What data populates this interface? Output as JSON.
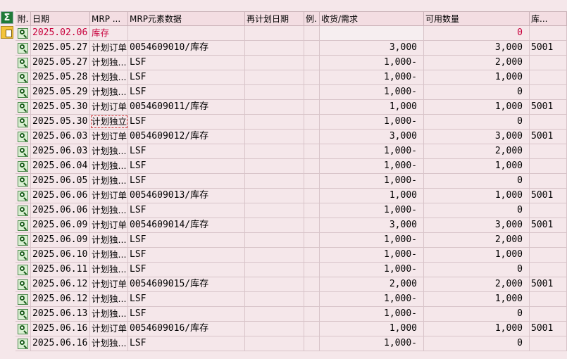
{
  "toolbar": {
    "sum_glyph": "Σ"
  },
  "columns": {
    "att": "附.",
    "date": "日期",
    "mrp": "MRP ...",
    "elem": "MRP元素数据",
    "resched": "再计划日期",
    "ex": "例.",
    "recv": "收货/需求",
    "avail": "可用数量",
    "stor": "库..."
  },
  "rows": [
    {
      "date": "2025.02.06",
      "mrp": "库存",
      "elem": "",
      "recv": "",
      "avail": "0",
      "stor": ""
    },
    {
      "date": "2025.05.27",
      "mrp": "计划订单",
      "elem": "0054609010/库存",
      "recv": "3,000",
      "avail": "3,000",
      "stor": "5001"
    },
    {
      "date": "2025.05.27",
      "mrp": "计划独...",
      "elem": "LSF",
      "recv": "1,000-",
      "avail": "2,000",
      "stor": ""
    },
    {
      "date": "2025.05.28",
      "mrp": "计划独...",
      "elem": "LSF",
      "recv": "1,000-",
      "avail": "1,000",
      "stor": ""
    },
    {
      "date": "2025.05.29",
      "mrp": "计划独...",
      "elem": "LSF",
      "recv": "1,000-",
      "avail": "0",
      "stor": ""
    },
    {
      "date": "2025.05.30",
      "mrp": "计划订单",
      "elem": "0054609011/库存",
      "recv": "1,000",
      "avail": "1,000",
      "stor": "5001"
    },
    {
      "date": "2025.05.30",
      "mrp": "计划独立需",
      "elem": "LSF",
      "recv": "1,000-",
      "avail": "0",
      "stor": ""
    },
    {
      "date": "2025.06.03",
      "mrp": "计划订单",
      "elem": "0054609012/库存",
      "recv": "3,000",
      "avail": "3,000",
      "stor": "5001"
    },
    {
      "date": "2025.06.03",
      "mrp": "计划独...",
      "elem": "LSF",
      "recv": "1,000-",
      "avail": "2,000",
      "stor": ""
    },
    {
      "date": "2025.06.04",
      "mrp": "计划独...",
      "elem": "LSF",
      "recv": "1,000-",
      "avail": "1,000",
      "stor": ""
    },
    {
      "date": "2025.06.05",
      "mrp": "计划独...",
      "elem": "LSF",
      "recv": "1,000-",
      "avail": "0",
      "stor": ""
    },
    {
      "date": "2025.06.06",
      "mrp": "计划订单",
      "elem": "0054609013/库存",
      "recv": "1,000",
      "avail": "1,000",
      "stor": "5001"
    },
    {
      "date": "2025.06.06",
      "mrp": "计划独...",
      "elem": "LSF",
      "recv": "1,000-",
      "avail": "0",
      "stor": ""
    },
    {
      "date": "2025.06.09",
      "mrp": "计划订单",
      "elem": "0054609014/库存",
      "recv": "3,000",
      "avail": "3,000",
      "stor": "5001"
    },
    {
      "date": "2025.06.09",
      "mrp": "计划独...",
      "elem": "LSF",
      "recv": "1,000-",
      "avail": "2,000",
      "stor": ""
    },
    {
      "date": "2025.06.10",
      "mrp": "计划独...",
      "elem": "LSF",
      "recv": "1,000-",
      "avail": "1,000",
      "stor": ""
    },
    {
      "date": "2025.06.11",
      "mrp": "计划独...",
      "elem": "LSF",
      "recv": "1,000-",
      "avail": "0",
      "stor": ""
    },
    {
      "date": "2025.06.12",
      "mrp": "计划订单",
      "elem": "0054609015/库存",
      "recv": "2,000",
      "avail": "2,000",
      "stor": "5001"
    },
    {
      "date": "2025.06.12",
      "mrp": "计划独...",
      "elem": "LSF",
      "recv": "1,000-",
      "avail": "1,000",
      "stor": ""
    },
    {
      "date": "2025.06.13",
      "mrp": "计划独...",
      "elem": "LSF",
      "recv": "1,000-",
      "avail": "0",
      "stor": ""
    },
    {
      "date": "2025.06.16",
      "mrp": "计划订单",
      "elem": "0054609016/库存",
      "recv": "1,000",
      "avail": "1,000",
      "stor": "5001"
    },
    {
      "date": "2025.06.16",
      "mrp": "计划独...",
      "elem": "LSF",
      "recv": "1,000-",
      "avail": "0",
      "stor": ""
    }
  ],
  "colors": {
    "row_bg": "#f5e7ea",
    "header_bg": "#f3dde2",
    "stock_row_text": "#c8003c",
    "sum_button": "#1f7a38",
    "layout_button": "#f4c43a"
  }
}
